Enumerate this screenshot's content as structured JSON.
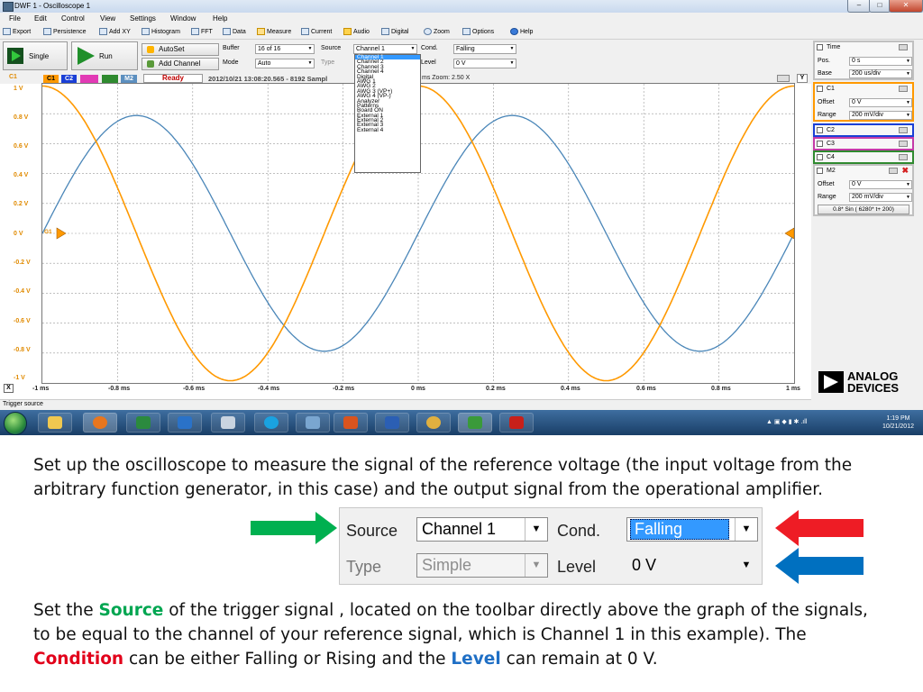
{
  "window": {
    "title": "DWF 1 - Oscilloscope 1",
    "controls": [
      "–",
      "□",
      "✕"
    ]
  },
  "menu": [
    "File",
    "Edit",
    "Control",
    "View",
    "Settings",
    "Window",
    "Help"
  ],
  "toolbar1": [
    "Export",
    "Persistence",
    "Add XY",
    "Histogram",
    "FFT",
    "Data",
    "Measure",
    "Current",
    "Audio",
    "Digital",
    "Zoom",
    "Options",
    "Help"
  ],
  "toolbar2": {
    "single": "Single",
    "run": "Run",
    "autoset": "AutoSet",
    "add_channel": "Add Channel",
    "buffer_label": "Buffer",
    "buffer_value": "16 of 16",
    "mode_label": "Mode",
    "mode_value": "Auto",
    "source_label": "Source",
    "source_value": "Channel 1",
    "type_label": "Type",
    "cond_label": "Cond.",
    "cond_value": "Falling",
    "level_label": "Level",
    "level_value": "0 V"
  },
  "dropdown_options": [
    "Channel 1",
    "Channel 2",
    "Channel 3",
    "Channel 4",
    "Digital",
    "AWG 1",
    "AWG 2",
    "AWG 3 (VP+)",
    "AWG 4 (VP-)",
    "Analyzer",
    "Patterns",
    "Board ON",
    "External 1",
    "External 2",
    "External 3",
    "External 4"
  ],
  "channel_strip": {
    "c1_label": "C1",
    "tags": [
      "C1",
      "C2",
      "",
      "",
      "M2"
    ],
    "status": "Ready",
    "info": "2012/10/21 13:08:20.565 - 8192 Sampl",
    "zoom": "ms Zoom: 2.50 X",
    "y_btn": "Y"
  },
  "y_axis": [
    "1 V",
    "0.8 V",
    "0.6 V",
    "0.4 V",
    "0.2 V",
    "0 V",
    "-0.2 V",
    "-0.4 V",
    "-0.6 V",
    "-0.8 V",
    "-1 V"
  ],
  "x_axis": [
    "-1 ms",
    "-0.8 ms",
    "-0.6 ms",
    "-0.4 ms",
    "-0.2 ms",
    "0 ms",
    "0.2 ms",
    "0.4 ms",
    "0.6 ms",
    "0.8 ms",
    "1 ms"
  ],
  "trigger_marker": "G1",
  "close_plot": "X",
  "status_text": "Trigger source",
  "traces": {
    "c1": {
      "color": "#ff9900",
      "amplitude": 1.0,
      "phase": 90
    },
    "m2": {
      "color": "#4a86b8",
      "amplitude": 0.8,
      "phase": 0
    }
  },
  "right_panel": {
    "time": {
      "title": "Time",
      "pos_label": "Pos.",
      "pos_value": "0 s",
      "base_label": "Base",
      "base_value": "200 us/div"
    },
    "c1": {
      "title": "C1",
      "offset_label": "Offset",
      "offset_value": "0 V",
      "range_label": "Range",
      "range_value": "200 mV/div",
      "color": "#ff9900"
    },
    "c2": {
      "title": "C2",
      "color": "#1a3fd6"
    },
    "c3": {
      "title": "C3",
      "color": "#c43aa8"
    },
    "c4": {
      "title": "C4",
      "color": "#2f8a2f"
    },
    "m2": {
      "title": "M2",
      "offset_label": "Offset",
      "offset_value": "0 V",
      "range_label": "Range",
      "range_value": "200 mV/div",
      "formula": "0.8* Sin ( 6280* t+ 200)"
    }
  },
  "logo": {
    "line1": "ANALOG",
    "line2": "DEVICES"
  },
  "taskbar": {
    "time": "1:19 PM",
    "date": "10/21/2012"
  },
  "slide": {
    "para1": "Set up the oscilloscope to measure the signal of the reference voltage (the input voltage from the arbitrary function generator, in this case) and the output signal from the operational amplifier.",
    "para2_a": "Set the ",
    "para2_source": "Source",
    "para2_b": " of the trigger signal , located on the toolbar directly above the graph of the signals, to be equal to the channel of your reference signal, which is Channel 1 in this example).  The ",
    "para2_condition": "Condition",
    "para2_c": " can be either Falling or Rising and the ",
    "para2_level": "Level",
    "para2_d": " can remain at 0 V."
  },
  "zoom_panel": {
    "source_label": "Source",
    "source_value": "Channel 1",
    "cond_label": "Cond.",
    "cond_value": "Falling",
    "type_label": "Type",
    "type_value": "Simple",
    "level_label": "Level",
    "level_value": "0 V"
  },
  "colors": {
    "arrow_green": "#00b050",
    "arrow_red": "#ee1c25",
    "arrow_blue": "#0070c0",
    "selection": "#3399ff"
  }
}
